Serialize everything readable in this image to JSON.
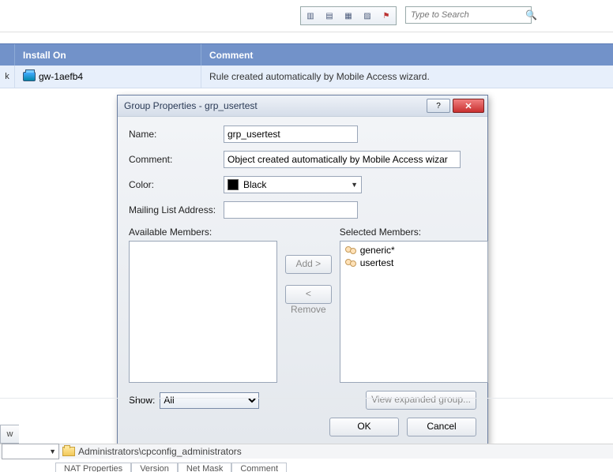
{
  "toolbar": {
    "search_placeholder": "Type to Search"
  },
  "table": {
    "headers": {
      "install_on": "Install On",
      "comment": "Comment"
    },
    "row": {
      "ck": "k",
      "install_on": "gw-1aefb4",
      "comment": "Rule created automatically by Mobile Access wizard."
    }
  },
  "dialog": {
    "title": "Group Properties - grp_usertest",
    "labels": {
      "name": "Name:",
      "comment": "Comment:",
      "color": "Color:",
      "mailing": "Mailing List Address:",
      "available": "Available Members:",
      "selected": "Selected Members:",
      "show": "Show:"
    },
    "values": {
      "name": "grp_usertest",
      "comment": "Object created automatically by Mobile Access wizar",
      "color": "Black",
      "mailing": "",
      "show": "All"
    },
    "selected_members": [
      "generic*",
      "usertest"
    ],
    "buttons": {
      "add": "Add >",
      "remove": "< Remove",
      "view_expanded": "View expanded group...",
      "ok": "OK",
      "cancel": "Cancel"
    }
  },
  "bottom": {
    "tab_w": "w",
    "breadcrumb": "Administrators\\cpconfig_administrators",
    "tabs": [
      "NAT Properties",
      "Version",
      "Net Mask",
      "Comment"
    ]
  }
}
